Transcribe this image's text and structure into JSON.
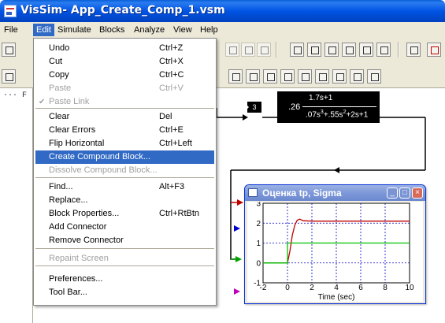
{
  "window": {
    "title": "VisSim- App_Create_Comp_1.vsm"
  },
  "menubar": {
    "items": [
      "File",
      "Edit",
      "Simulate",
      "Blocks",
      "Analyze",
      "View",
      "Help"
    ],
    "active": "Edit"
  },
  "tree": {
    "root_label": "··· F"
  },
  "diagram": {
    "small_block_label": "3",
    "tf_gain": ".26",
    "tf_numerator": "1.7s+1",
    "tf_denominator_a": ".07s",
    "tf_denominator_b": "3",
    "tf_denominator_c": "+.55s",
    "tf_denominator_d": "2",
    "tf_denominator_e": "+2s+1"
  },
  "edit_menu": {
    "items": [
      {
        "label": "Undo",
        "shortcut": "Ctrl+Z",
        "state": "enabled"
      },
      {
        "label": "Cut",
        "shortcut": "Ctrl+X",
        "state": "enabled"
      },
      {
        "label": "Copy",
        "shortcut": "Ctrl+C",
        "state": "enabled"
      },
      {
        "label": "Paste",
        "shortcut": "Ctrl+V",
        "state": "disabled"
      },
      {
        "label": "Paste Link",
        "shortcut": "",
        "state": "disabled-checked"
      },
      {
        "label": "Clear",
        "shortcut": "Del",
        "state": "enabled"
      },
      {
        "label": "Clear Errors",
        "shortcut": "Ctrl+E",
        "state": "enabled"
      },
      {
        "label": "Flip Horizontal",
        "shortcut": "Ctrl+Left",
        "state": "enabled"
      },
      {
        "label": "Create Compound Block...",
        "shortcut": "",
        "state": "highlighted"
      },
      {
        "label": "Dissolve Compound Block...",
        "shortcut": "",
        "state": "disabled"
      },
      {
        "label": "Find...",
        "shortcut": "Alt+F3",
        "state": "enabled"
      },
      {
        "label": "Replace...",
        "shortcut": "",
        "state": "enabled"
      },
      {
        "label": "Block Properties...",
        "shortcut": "Ctrl+RtBtn",
        "state": "enabled"
      },
      {
        "label": "Add Connector",
        "shortcut": "",
        "state": "enabled"
      },
      {
        "label": "Remove Connector",
        "shortcut": "",
        "state": "enabled"
      },
      {
        "label": "Repaint Screen",
        "shortcut": "",
        "state": "disabled"
      },
      {
        "label": "Preferences...",
        "shortcut": "",
        "state": "enabled"
      },
      {
        "label": "Tool Bar...",
        "shortcut": "",
        "state": "enabled"
      }
    ]
  },
  "plot_window": {
    "title": "Оценка tp, Sigma",
    "buttons": {
      "minimize": "_",
      "maximize": "□",
      "close": "×"
    }
  },
  "colors": {
    "series_red": "#c00000",
    "series_green": "#00c000",
    "grid": "#0000c0",
    "menu_highlight": "#316ac5"
  },
  "chart_data": {
    "type": "line",
    "xlabel": "Time (sec)",
    "ylabel": "",
    "xlim": [
      -2,
      10
    ],
    "ylim": [
      -1,
      3
    ],
    "xticks": [
      -2,
      0,
      2,
      4,
      6,
      8,
      10
    ],
    "yticks": [
      -1,
      0,
      1,
      2,
      3
    ],
    "grid": true,
    "series": [
      {
        "color": "#c00000",
        "x": [
          -2,
          0,
          0.2,
          0.4,
          0.6,
          0.8,
          1,
          1.3,
          2,
          4,
          6,
          8,
          10
        ],
        "y": [
          0,
          0,
          0.6,
          1.4,
          1.9,
          2.15,
          2.2,
          2.12,
          2.1,
          2.1,
          2.1,
          2.1,
          2.1
        ]
      },
      {
        "color": "#00c000",
        "x": [
          -2,
          0,
          0,
          10
        ],
        "y": [
          0,
          0,
          1,
          1
        ]
      }
    ]
  }
}
